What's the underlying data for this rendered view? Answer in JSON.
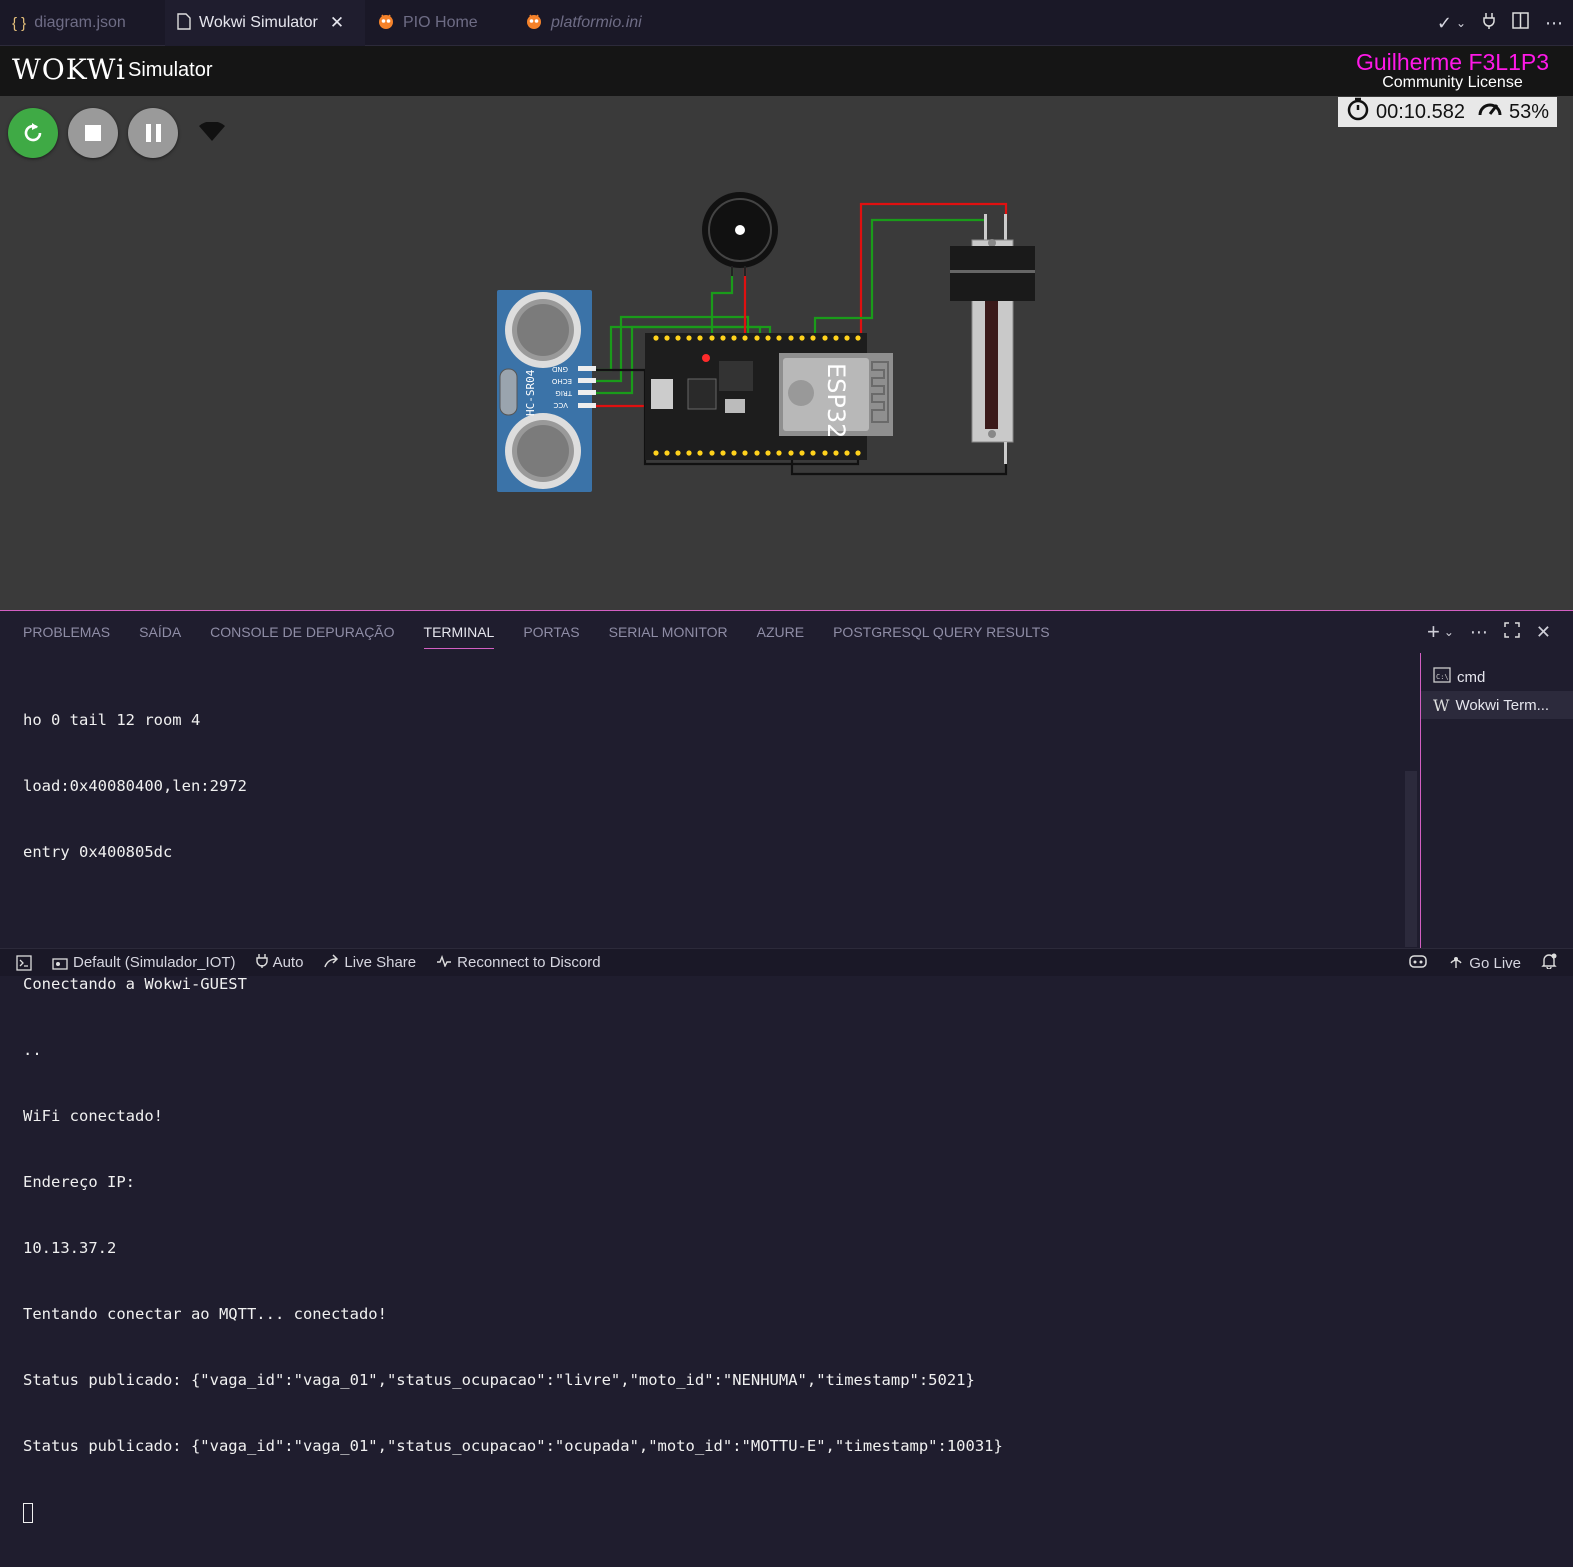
{
  "tabs": [
    {
      "label": "diagram.json",
      "icon": "braces-icon"
    },
    {
      "label": "Wokwi Simulator",
      "icon": "file-icon",
      "active": true
    },
    {
      "label": "PIO Home",
      "icon": "platformio-icon"
    },
    {
      "label": "platformio.ini",
      "icon": "platformio-icon"
    }
  ],
  "tab_close": "✕",
  "header": {
    "logo": "WOKWi",
    "title": "Simulator",
    "user_name": "Guilherme F3L1P3",
    "license": "Community License"
  },
  "sim": {
    "time": "00:10.582",
    "speed": "53%"
  },
  "components": {
    "sensor_label": "HC-SR04",
    "sensor_pins": [
      "GND",
      "ECHO",
      "TRIG",
      "VCC"
    ],
    "board_label": "ESP32"
  },
  "panel": {
    "tabs": [
      "PROBLEMAS",
      "SAÍDA",
      "CONSOLE DE DEPURAÇÃO",
      "TERMINAL",
      "PORTAS",
      "SERIAL MONITOR",
      "AZURE",
      "POSTGRESQL QUERY RESULTS"
    ],
    "active_tab": "TERMINAL",
    "terminal_lines": [
      "ho 0 tail 12 room 4",
      "load:0x40080400,len:2972",
      "entry 0x400805dc",
      "",
      "Conectando a Wokwi-GUEST",
      "..",
      "WiFi conectado!",
      "Endereço IP:",
      "10.13.37.2",
      "Tentando conectar ao MQTT... conectado!",
      "Status publicado: {\"vaga_id\":\"vaga_01\",\"status_ocupacao\":\"livre\",\"moto_id\":\"NENHUMA\",\"timestamp\":5021}",
      "Status publicado: {\"vaga_id\":\"vaga_01\",\"status_ocupacao\":\"ocupada\",\"moto_id\":\"MOTTU-E\",\"timestamp\":10031}"
    ],
    "terminals": [
      {
        "label": "cmd",
        "icon": "cmd-icon"
      },
      {
        "label": "Wokwi Term...",
        "icon": "wokwi-icon"
      }
    ]
  },
  "status": {
    "profile": "Default (Simulador_IOT)",
    "auto": "Auto",
    "live_share": "Live Share",
    "discord": "Reconnect to Discord",
    "go_live": "Go Live"
  },
  "colors": {
    "accent": "#d25fc2",
    "user_name": "#ff18e8",
    "play_button": "#3faa45"
  }
}
